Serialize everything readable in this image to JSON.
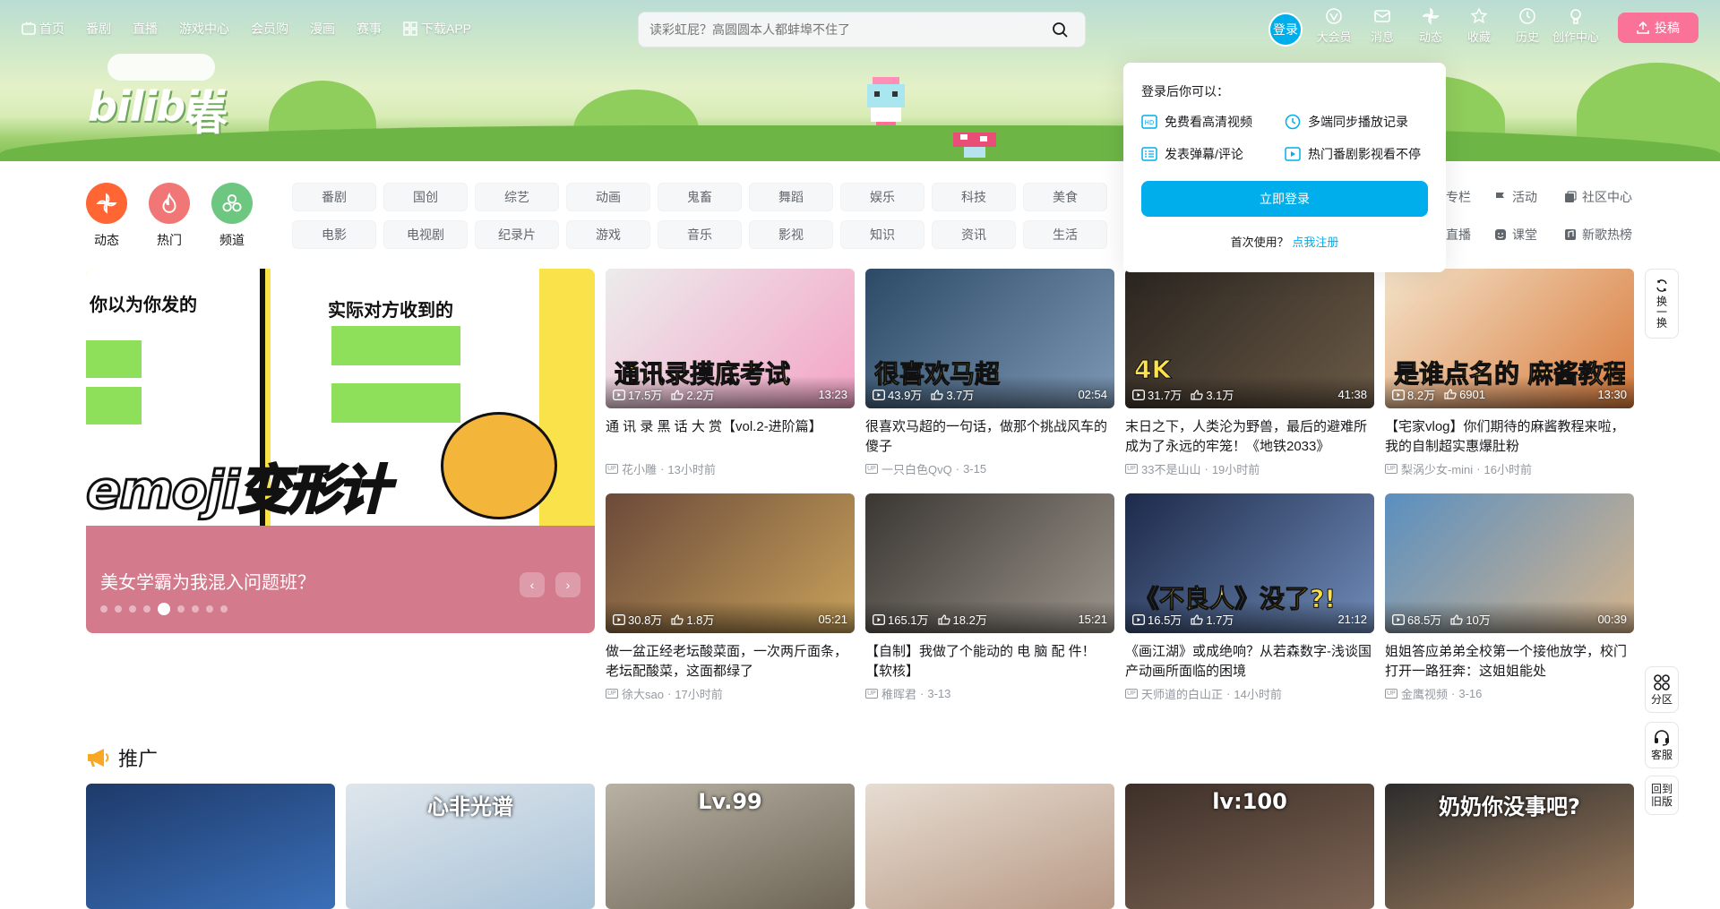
{
  "topnav": {
    "left": [
      {
        "label": "首页",
        "icon": "tv-icon"
      },
      {
        "label": "番剧"
      },
      {
        "label": "直播"
      },
      {
        "label": "游戏中心"
      },
      {
        "label": "会员购"
      },
      {
        "label": "漫画"
      },
      {
        "label": "赛事"
      },
      {
        "label": "下载APP",
        "icon": "download-icon"
      }
    ],
    "search_placeholder": "读彩虹屁？高圆圆本人都蚌埠不住了",
    "login_label": "登录",
    "right": [
      {
        "label": "大会员",
        "icon": "vip-icon"
      },
      {
        "label": "消息",
        "icon": "message-icon"
      },
      {
        "label": "动态",
        "icon": "dynamic-icon"
      },
      {
        "label": "收藏",
        "icon": "star-icon"
      },
      {
        "label": "历史",
        "icon": "history-icon"
      },
      {
        "label": "创作中心",
        "icon": "creator-icon"
      }
    ],
    "upload_label": "投稿"
  },
  "banner": {
    "logo": "bilibili",
    "logo_extra": "春"
  },
  "channels": {
    "circles": [
      {
        "label": "动态",
        "color": "#ff6633"
      },
      {
        "label": "热门",
        "color": "#f07775"
      },
      {
        "label": "频道",
        "color": "#6dc781"
      }
    ],
    "row1": [
      "番剧",
      "国创",
      "综艺",
      "动画",
      "鬼畜",
      "舞蹈",
      "娱乐",
      "科技",
      "美食"
    ],
    "row2": [
      "电影",
      "电视剧",
      "纪录片",
      "游戏",
      "音乐",
      "影视",
      "知识",
      "资讯",
      "生活"
    ],
    "side_links": [
      {
        "label": "专栏"
      },
      {
        "label": "活动"
      },
      {
        "label": "社区中心"
      },
      {
        "label": "直播"
      },
      {
        "label": "课堂"
      },
      {
        "label": "新歌热榜"
      }
    ]
  },
  "login_popover": {
    "title": "登录后你可以：",
    "features": [
      "免费看高清视频",
      "多端同步播放记录",
      "发表弹幕/评论",
      "热门番剧影视看不停"
    ],
    "button": "立即登录",
    "register_prefix": "首次使用？",
    "register_link": "点我注册"
  },
  "carousel": {
    "caption": "美女学霸为我混入问题班？",
    "art_text_1": "你以为你发的",
    "art_text_2": "实际对方收到的",
    "art_big": "emoji变形计",
    "dots": 9,
    "active_dot": 4
  },
  "videos": [
    {
      "views": "17.5万",
      "danmaku": "2.2万",
      "duration": "13:23",
      "title": "通 讯 录 黑 话 大 赏【vol.2-进阶篇】",
      "up": "花小雕",
      "time": "13小时前",
      "overlay": "通讯录摸底考试",
      "color1": "#ececec",
      "color2": "#f4a3c6"
    },
    {
      "views": "43.9万",
      "danmaku": "3.7万",
      "duration": "02:54",
      "title": "很喜欢马超的一句话，做那个挑战风车的傻子",
      "up": "一只白色QvQ",
      "time": "3-15",
      "overlay": "很喜欢马超",
      "color1": "#2c4a66",
      "color2": "#7d98b5"
    },
    {
      "views": "31.7万",
      "danmaku": "3.1万",
      "duration": "41:38",
      "title": "末日之下，人类沦为野兽，最后的避难所成为了永远的牢笼！《地铁2033》",
      "up": "33不是山山",
      "time": "19小时前",
      "overlay": "4K",
      "color1": "#2a2520",
      "color2": "#6b5a46"
    },
    {
      "views": "8.2万",
      "danmaku": "6901",
      "duration": "13:30",
      "title": "【宅家vlog】你们期待的麻酱教程来啦，我的自制超实惠爆肚粉",
      "up": "梨涡少女-mini",
      "time": "16小时前",
      "overlay": "是谁点名的 麻酱教程来啦",
      "color1": "#f3e2c8",
      "color2": "#d97b3c"
    },
    {
      "views": "30.8万",
      "danmaku": "1.8万",
      "duration": "05:21",
      "title": "做一盆正经老坛酸菜面，一次两斤面条，老坛配酸菜，这面都绿了",
      "up": "徐大sao",
      "time": "17小时前",
      "overlay": "",
      "color1": "#6b4a3a",
      "color2": "#c8a15a"
    },
    {
      "views": "165.1万",
      "danmaku": "18.2万",
      "duration": "15:21",
      "title": "【自制】我做了个能动的 电 脑 配 件！【软核】",
      "up": "稚晖君",
      "time": "3-13",
      "overlay": "",
      "color1": "#3a3632",
      "color2": "#9c958c"
    },
    {
      "views": "16.5万",
      "danmaku": "1.7万",
      "duration": "21:12",
      "title": "《画江湖》或成绝响？从若森数字-浅谈国产动画所面临的困境",
      "up": "天师道的白山正",
      "time": "14小时前",
      "overlay": "《不良人》没了?!",
      "color1": "#1d2a4a",
      "color2": "#6f8bb8"
    },
    {
      "views": "68.5万",
      "danmaku": "10万",
      "duration": "00:39",
      "title": "姐姐答应弟弟全校第一个接他放学，校门打开一路狂奔：这姐姐能处",
      "up": "金鹰视频",
      "time": "3-16",
      "overlay": "",
      "color1": "#5a8fc0",
      "color2": "#d5b48c"
    }
  ],
  "float_buttons": [
    {
      "label": "换一换"
    },
    {
      "label": "分区"
    },
    {
      "label": "客服"
    },
    {
      "label": "回到旧版"
    }
  ],
  "promo": {
    "title": "推广",
    "items": [
      {
        "color1": "#1e3a6a",
        "color2": "#3a6fb8",
        "text": ""
      },
      {
        "color1": "#dfe6ec",
        "color2": "#a9c3d8",
        "text": "心非光谱"
      },
      {
        "color1": "#b8b2a4",
        "color2": "#6d6455",
        "text": "Lv.99"
      },
      {
        "color1": "#e7ddd2",
        "color2": "#b89a86",
        "text": ""
      },
      {
        "color1": "#3d2f28",
        "color2": "#7e6555",
        "text": "lv:100"
      },
      {
        "color1": "#2c2c2c",
        "color2": "#9a7a5c",
        "text": "奶奶你没事吧?"
      }
    ]
  }
}
